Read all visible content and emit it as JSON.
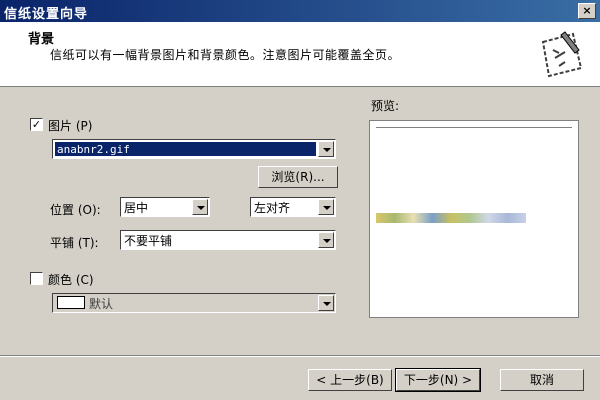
{
  "window": {
    "title": "信纸设置向导",
    "close": "×"
  },
  "header": {
    "title": "背景",
    "description": "信纸可以有一幅背景图片和背景颜色。注意图片可能覆盖全页。"
  },
  "picture": {
    "checkbox_label": "图片 (P)",
    "checked": true,
    "file": "anabnr2.gif",
    "browse": "浏览(R)..."
  },
  "position": {
    "label": "位置 (O):",
    "value": "居中",
    "align_value": "左对齐"
  },
  "tile": {
    "label": "平铺 (T):",
    "value": "不要平铺"
  },
  "color": {
    "checkbox_label": "颜色 (C)",
    "checked": false,
    "value": "默认"
  },
  "preview": {
    "label": "预览:"
  },
  "buttons": {
    "back": "< 上一步(B)",
    "next": "下一步(N) >",
    "cancel": "取消"
  }
}
